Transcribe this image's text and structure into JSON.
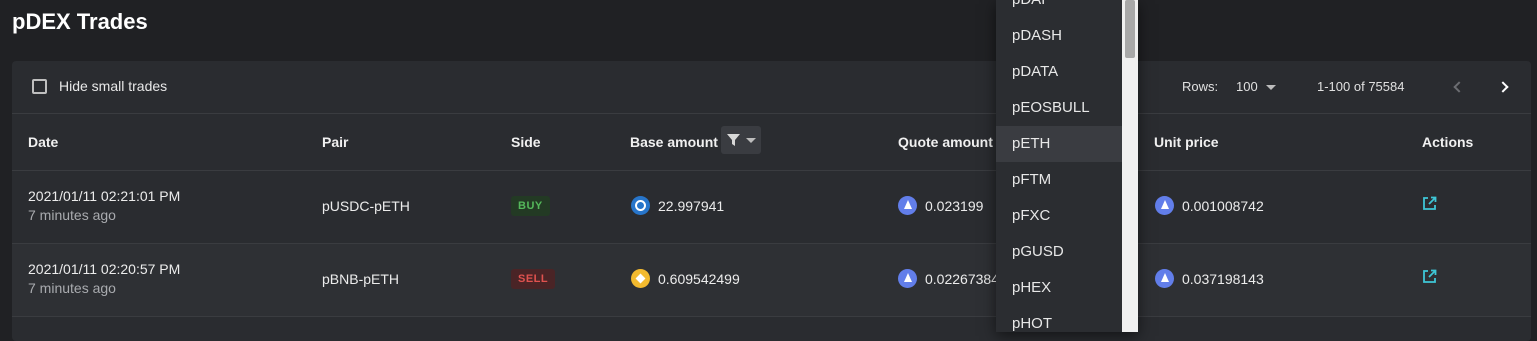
{
  "page": {
    "title": "pDEX Trades"
  },
  "toolbar": {
    "hide_small_label": "Hide small trades",
    "hide_small_checked": false,
    "rows_label": "Rows:",
    "rows_value": "100",
    "page_range": "1-100 of 75584"
  },
  "table": {
    "columns": [
      "Date",
      "Pair",
      "Side",
      "Base amount",
      "Quote amount",
      "Unit price",
      "Actions"
    ],
    "rows": [
      {
        "date": "2021/01/11 02:21:01 PM",
        "ago": "7 minutes ago",
        "pair": "pUSDC-pETH",
        "side": "BUY",
        "base_icon": "usdc-coin-icon",
        "base_amount": "22.997941",
        "quote_icon": "eth-coin-icon",
        "quote_amount": "0.023199",
        "unit_icon": "eth-coin-icon",
        "unit_price": "0.001008742",
        "action_icon": "external-link-icon"
      },
      {
        "date": "2021/01/11 02:20:57 PM",
        "ago": "7 minutes ago",
        "pair": "pBNB-pETH",
        "side": "SELL",
        "base_icon": "bnb-coin-icon",
        "base_amount": "0.609542499",
        "quote_icon": "eth-coin-icon",
        "quote_amount": "0.02267384",
        "unit_icon": "eth-coin-icon",
        "unit_price": "0.037198143",
        "action_icon": "external-link-icon"
      }
    ]
  },
  "dropdown": {
    "items": [
      "pDAI",
      "pDASH",
      "pDATA",
      "pEOSBULL",
      "pETH",
      "pFTM",
      "pFXC",
      "pGUSD",
      "pHEX",
      "pHOT"
    ],
    "hovered": "pETH"
  },
  "colors": {
    "background": "#202124",
    "card": "#2a2c30",
    "buy": "#55b85b",
    "sell": "#e0524f",
    "link": "#3ec6d6"
  }
}
